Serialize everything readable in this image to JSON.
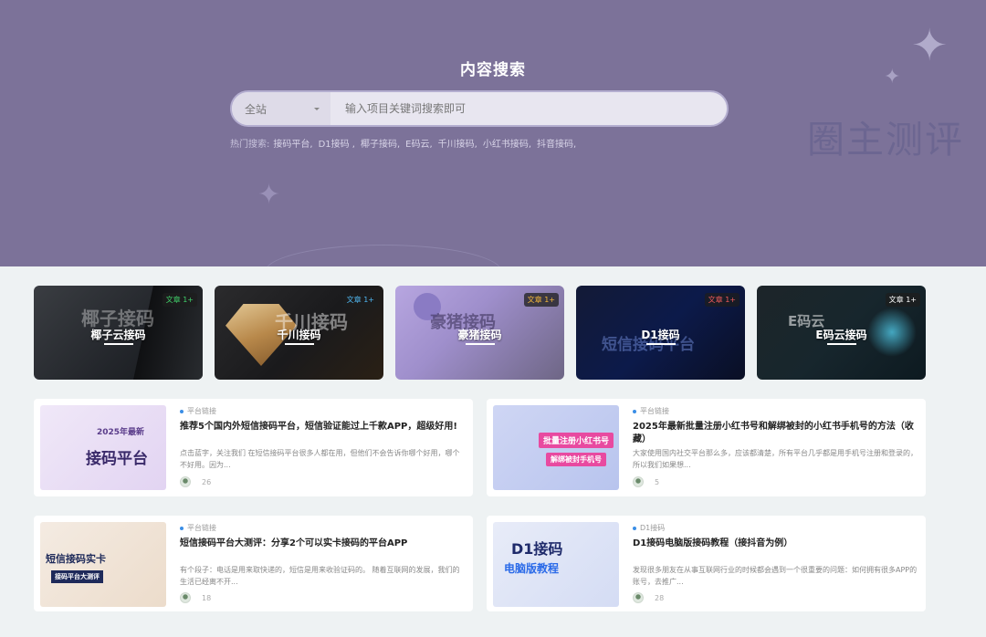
{
  "hero": {
    "title": "内容搜索",
    "search": {
      "scope": "全站",
      "placeholder": "输入项目关键词搜索即可"
    },
    "hot_label": "热门搜索:",
    "hot_terms": [
      "接码平台,",
      "D1接码 ,",
      "椰子接码,",
      "E码云,",
      "千川接码,",
      "小红书接码,",
      "抖音接码,"
    ],
    "watermark": "圈主测评"
  },
  "categories": [
    {
      "name": "椰子云接码",
      "badge": "文章 1+",
      "badge_color": "#3fcf6a",
      "art": "椰子接码"
    },
    {
      "name": "千川接码",
      "badge": "文章 1+",
      "badge_color": "#4fb6f0",
      "art": "千川接码"
    },
    {
      "name": "豪猪接码",
      "badge": "文章 1+",
      "badge_color": "#f3b63a",
      "art": "豪猪接码"
    },
    {
      "name": "D1接码",
      "badge": "文章 1+",
      "badge_color": "#ef5a5a",
      "art": "短信接码平台"
    },
    {
      "name": "E码云接码",
      "badge": "文章 1+",
      "badge_color": "#ffffff",
      "art": "E码云"
    }
  ],
  "articles": [
    {
      "category": "平台链接",
      "title": "推荐5个国内外短信接码平台，短信验证能过上千款APP，超级好用!",
      "excerpt": "点击蓝字，关注我们 在短信接码平台很多人都在用，但他们不会告诉你哪个好用，哪个不好用。因为...",
      "count": "26",
      "thumb_title": "接码平台",
      "thumb_sub": "2025年最新"
    },
    {
      "category": "平台链接",
      "title": "2025年最新批量注册小红书号和解绑被封的小红书手机号的方法（收藏）",
      "excerpt": "大家使用国内社交平台那么多，应该都清楚，所有平台几乎都是用手机号注册和登录的，所以我们如果想...",
      "count": "5",
      "thumb_title": "批量注册小红书号",
      "thumb_sub": "解绑被封手机号"
    },
    {
      "category": "平台链接",
      "title": "短信接码平台大测评：分享2个可以实卡接码的平台APP",
      "excerpt": "有个段子：电话是用来取快递的，短信是用来收验证码的。 随着互联网的发展，我们的生活已经离不开...",
      "count": "18",
      "thumb_title": "短信接码实卡",
      "thumb_sub": "接码平台大测评"
    },
    {
      "category": "D1接码",
      "title": "D1接码电脑版接码教程（接抖音为例）",
      "excerpt": "发现很多朋友在从事互联网行业的时候都会遇到一个很重要的问题：如何拥有很多APP的账号，去推广...",
      "count": "28",
      "thumb_title": "D1接码",
      "thumb_sub": "电脑版教程"
    }
  ]
}
